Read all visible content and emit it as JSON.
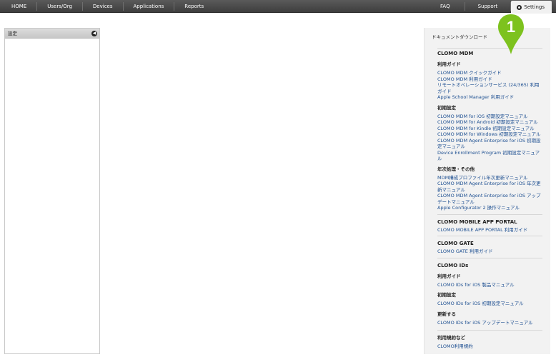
{
  "nav": {
    "left": [
      "HOME",
      "Users/Org",
      "Devices",
      "Applications",
      "Reports"
    ],
    "faq": "FAQ",
    "support": "Support",
    "settings": "Settings"
  },
  "left_panel": {
    "title": "設定"
  },
  "right_panel": {
    "title": "ドキュメントダウンロード",
    "sections": {
      "mdm": "CLOMO MDM",
      "mdm_guide_head": "利用ガイド",
      "mdm_guide_links": [
        "CLOMO MDM クイックガイド",
        "CLOMO MDM 利用ガイド",
        "リモートオペレーションサービス (24/365) 利用ガイド",
        "Apple School Manager 利用ガイド"
      ],
      "mdm_init_head": "初期設定",
      "mdm_init_links": [
        "CLOMO MDM for iOS 初期設定マニュアル",
        "CLOMO MDM for Android 初期設定マニュアル",
        "CLOMO MDM for Kindle 初期設定マニュアル",
        "CLOMO MDM for Windows 初期設定マニュアル",
        "CLOMO MDM Agent Enterprise for iOS 初期設定マニュアル",
        "Device Enrollment Program 初期設定マニュアル"
      ],
      "mdm_yearly_head": "年次処理・その他",
      "mdm_yearly_links": [
        "MDM構成プロファイル年次更新マニュアル",
        "CLOMO MDM Agent Enterprise for iOS 年次更新マニュアル",
        "CLOMO MDM Agent Enterprise for iOS アップデートマニュアル",
        "Apple Configurator 2 操作マニュアル"
      ],
      "portal": "CLOMO MOBILE APP PORTAL",
      "portal_links": [
        "CLOMO MOBILE APP PORTAL 利用ガイド"
      ],
      "gate": "CLOMO GATE",
      "gate_links": [
        "CLOMO GATE 利用ガイド"
      ],
      "ids": "CLOMO IDs",
      "ids_guide_head": "利用ガイド",
      "ids_guide_links": [
        "CLOMO IDs for iOS 製品マニュアル"
      ],
      "ids_init_head": "初期設定",
      "ids_init_links": [
        "CLOMO IDs for iOS 初期設定マニュアル"
      ],
      "ids_update_head": "更新する",
      "ids_update_links": [
        "CLOMO IDs for iOS アップデートマニュアル"
      ],
      "terms_head": "利用規約など",
      "terms_links": [
        "CLOMO利用規約"
      ]
    }
  },
  "marker": {
    "label": "1",
    "color": "#7dc21e"
  }
}
